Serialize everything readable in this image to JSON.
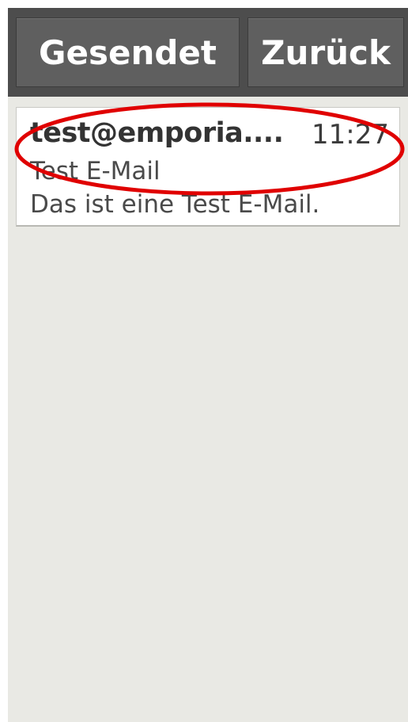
{
  "toolbar": {
    "sent_label": "Gesendet",
    "back_label": "Zurück"
  },
  "messages": [
    {
      "sender": "test@emporia....",
      "time": "11:27",
      "subject": "Test E-Mail",
      "preview": "Das ist eine Test E-Mail."
    }
  ],
  "colors": {
    "toolbar_background": "#4d4d4d",
    "button_background": "#5f5f5f",
    "list_background": "#e9e9e4",
    "highlight_ring": "#e00000"
  }
}
